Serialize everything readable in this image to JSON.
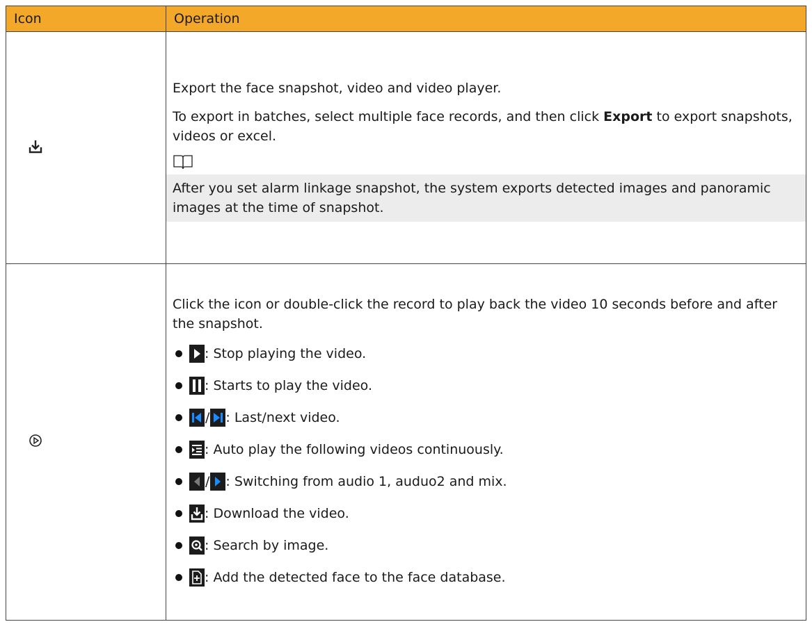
{
  "header": {
    "icon_col": "Icon",
    "operation_col": "Operation"
  },
  "rows": [
    {
      "icon": "download-icon",
      "p1": "Export the face snapshot, video and video player.",
      "p2_a": "To export in batches, select multiple face records, and then click ",
      "p2_bold": "Export",
      "p2_b": "  to export snapshots, videos or excel.",
      "note_icon": "book-icon",
      "note": "After you set alarm linkage snapshot, the system exports detected images and panoramic images at the time of snapshot."
    },
    {
      "icon": "play-circle-icon",
      "intro": "Click the icon or double-click the record to play back the video 10 seconds before and after the snapshot.",
      "bullets": [
        {
          "icons": [
            "play-icon"
          ],
          "text": ": Stop playing the video."
        },
        {
          "icons": [
            "pause-icon"
          ],
          "text": ": Starts to play the video."
        },
        {
          "icons": [
            "previous-video-icon",
            "next-video-icon"
          ],
          "separator": "/",
          "text": ": Last/next video."
        },
        {
          "icons": [
            "auto-play-list-icon"
          ],
          "text": ": Auto play the following videos continuously."
        },
        {
          "icons": [
            "audio-left-icon",
            "audio-right-icon"
          ],
          "separator": "/",
          "text": ": Switching from audio 1, auduo2 and mix."
        },
        {
          "icons": [
            "download-video-icon"
          ],
          "text": ": Download the video."
        },
        {
          "icons": [
            "search-by-image-icon"
          ],
          "text": ": Search by image."
        },
        {
          "icons": [
            "add-to-database-icon"
          ],
          "text": ": Add the detected face to the face database."
        }
      ]
    }
  ]
}
